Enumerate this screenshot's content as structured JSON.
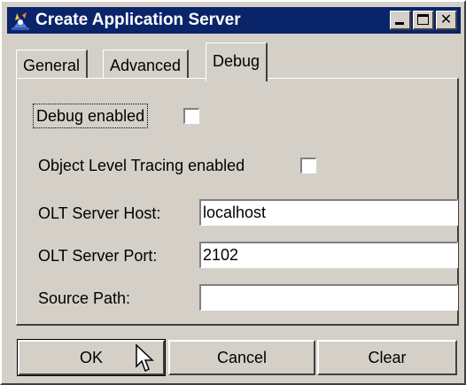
{
  "window": {
    "title": "Create Application Server",
    "icon": "app-server-icon",
    "controls": {
      "minimize": "minimize-icon",
      "maximize": "maximize-icon",
      "close": "close-icon"
    }
  },
  "tabs": [
    {
      "label": "General",
      "active": false
    },
    {
      "label": "Advanced",
      "active": false
    },
    {
      "label": "Debug",
      "active": true
    }
  ],
  "debug": {
    "debug_enabled_label": "Debug enabled",
    "debug_enabled_checked": false,
    "olt_enabled_label": "Object Level Tracing enabled",
    "olt_enabled_checked": false,
    "olt_host_label": "OLT Server Host:",
    "olt_host_value": "localhost",
    "olt_port_label": "OLT Server Port:",
    "olt_port_value": "2102",
    "source_path_label": "Source Path:",
    "source_path_value": ""
  },
  "buttons": {
    "ok": "OK",
    "cancel": "Cancel",
    "clear": "Clear"
  },
  "colors": {
    "titlebar": "#0a246a",
    "face": "#d4d0c8"
  }
}
